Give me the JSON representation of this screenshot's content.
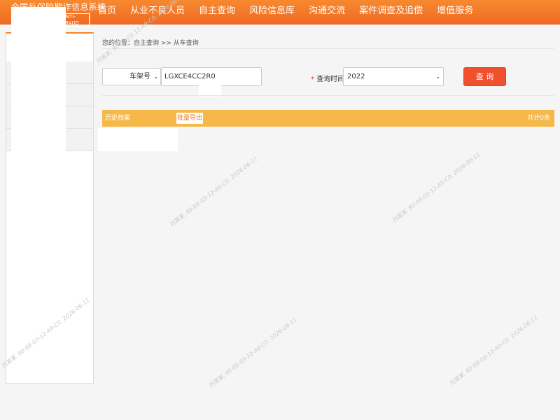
{
  "header": {
    "logo_title": "全国反保险欺诈信息系统",
    "logo_sub": "ANTI-FRAUD",
    "nav": [
      "首页",
      "从业不良人员",
      "自主查询",
      "风险信息库",
      "沟通交流",
      "案件调查及追偿",
      "增值服务"
    ]
  },
  "breadcrumb": "您的位置：自主查询 >> 从车查询",
  "search": {
    "type_value": "车架号",
    "vin_value": "LGXCE4CC2R0",
    "query_label": "查询时间:",
    "required_mark": "*",
    "year_value": "2022",
    "query_button": "查 询"
  },
  "table": {
    "history_label": "历史档案",
    "export_button": "批量导出",
    "total": "共计0条"
  },
  "watermark_text": "刘某某, 80-88-03-12-A9-C0, 2026-06-11",
  "colors": {
    "accent": "#f47a2a",
    "bar": "#f7b84a",
    "button": "#f0502e"
  }
}
